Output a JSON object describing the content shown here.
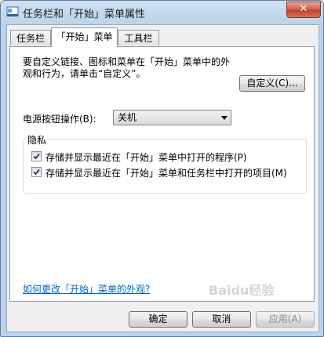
{
  "window": {
    "title": "任务栏和「开始」菜单属性",
    "close_glyph": "✕"
  },
  "tabs": [
    {
      "label": "任务栏",
      "active": false
    },
    {
      "label": "「开始」菜单",
      "active": true
    },
    {
      "label": "工具栏",
      "active": false
    }
  ],
  "start_menu": {
    "description": "要自定义链接、图标和菜单在「开始」菜单中的外观和行为，请单击“自定义”。",
    "customize_button": "自定义(C)...",
    "power_label": "电源按钮操作(B):",
    "power_value": "关机",
    "privacy_title": "隐私",
    "privacy_options": [
      {
        "label": "存储并显示最近在「开始」菜单中打开的程序(P)",
        "checked": true
      },
      {
        "label": "存储并显示最近在「开始」菜单和任务栏中打开的项目(M)",
        "checked": true
      }
    ],
    "help_link": "如何更改「开始」菜单的外观?"
  },
  "footer": {
    "ok": "确定",
    "cancel": "取消",
    "apply": "应用(A)"
  },
  "watermark": "Baidu经验",
  "colors": {
    "accent_link": "#0066cc",
    "close_red": "#c03c23",
    "title_bar": "#bcd3ea"
  }
}
